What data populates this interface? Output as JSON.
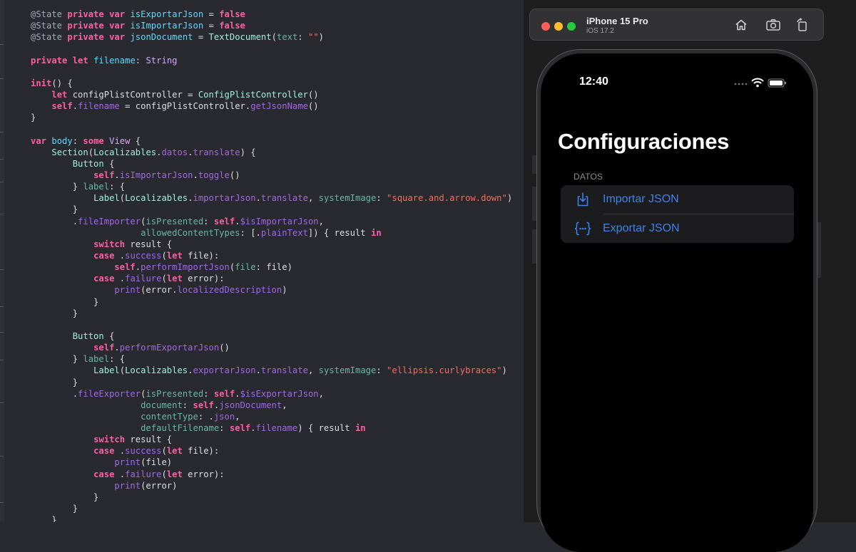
{
  "code": {
    "lines": [
      [
        [
          "at",
          "@State"
        ],
        [
          "pn",
          " "
        ],
        [
          "kw",
          "private"
        ],
        [
          "pn",
          " "
        ],
        [
          "kw",
          "var"
        ],
        [
          "pn",
          " "
        ],
        [
          "pr",
          "isExportarJson"
        ],
        [
          "pn",
          " = "
        ],
        [
          "kw",
          "false"
        ]
      ],
      [
        [
          "at",
          "@State"
        ],
        [
          "pn",
          " "
        ],
        [
          "kw",
          "private"
        ],
        [
          "pn",
          " "
        ],
        [
          "kw",
          "var"
        ],
        [
          "pn",
          " "
        ],
        [
          "pr",
          "isImportarJson"
        ],
        [
          "pn",
          " = "
        ],
        [
          "kw",
          "false"
        ]
      ],
      [
        [
          "at",
          "@State"
        ],
        [
          "pn",
          " "
        ],
        [
          "kw",
          "private"
        ],
        [
          "pn",
          " "
        ],
        [
          "kw",
          "var"
        ],
        [
          "pn",
          " "
        ],
        [
          "pr",
          "jsonDocument"
        ],
        [
          "pn",
          " = "
        ],
        [
          "cl",
          "TextDocument"
        ],
        [
          "pn",
          "("
        ],
        [
          "pt",
          "text"
        ],
        [
          "pn",
          ": "
        ],
        [
          "st",
          "\"\""
        ],
        [
          "pn",
          ")"
        ]
      ],
      [],
      [
        [
          "kw",
          "private"
        ],
        [
          "pn",
          " "
        ],
        [
          "kw",
          "let"
        ],
        [
          "pn",
          " "
        ],
        [
          "pr",
          "filename"
        ],
        [
          "pn",
          ": "
        ],
        [
          "ty",
          "String"
        ]
      ],
      [],
      [
        [
          "kw",
          "init"
        ],
        [
          "pn",
          "() {"
        ]
      ],
      [
        [
          "pn",
          "    "
        ],
        [
          "kw",
          "let"
        ],
        [
          "pn",
          " configPlistController = "
        ],
        [
          "cl",
          "ConfigPlistController"
        ],
        [
          "pn",
          "()"
        ]
      ],
      [
        [
          "pn",
          "    "
        ],
        [
          "kw",
          "self"
        ],
        [
          "pn",
          "."
        ],
        [
          "pm",
          "filename"
        ],
        [
          "pn",
          " = configPlistController."
        ],
        [
          "pm",
          "getJsonName"
        ],
        [
          "pn",
          "()"
        ]
      ],
      [
        [
          "pn",
          "}"
        ]
      ],
      [],
      [
        [
          "kw",
          "var"
        ],
        [
          "pn",
          " "
        ],
        [
          "pr",
          "body"
        ],
        [
          "pn",
          ": "
        ],
        [
          "kw",
          "some"
        ],
        [
          "pn",
          " "
        ],
        [
          "ty",
          "View"
        ],
        [
          "pn",
          " {"
        ]
      ],
      [
        [
          "pn",
          "    "
        ],
        [
          "cl",
          "Section"
        ],
        [
          "pn",
          "("
        ],
        [
          "cl",
          "Localizables"
        ],
        [
          "pn",
          "."
        ],
        [
          "pm",
          "datos"
        ],
        [
          "pn",
          "."
        ],
        [
          "pm",
          "translate"
        ],
        [
          "pn",
          ") {"
        ]
      ],
      [
        [
          "pn",
          "        "
        ],
        [
          "cl",
          "Button"
        ],
        [
          "pn",
          " {"
        ]
      ],
      [
        [
          "pn",
          "            "
        ],
        [
          "kw",
          "self"
        ],
        [
          "pn",
          "."
        ],
        [
          "pm",
          "isImportarJson"
        ],
        [
          "pn",
          "."
        ],
        [
          "pm",
          "toggle"
        ],
        [
          "pn",
          "()"
        ]
      ],
      [
        [
          "pn",
          "        } "
        ],
        [
          "pt",
          "label"
        ],
        [
          "pn",
          ": {"
        ]
      ],
      [
        [
          "pn",
          "            "
        ],
        [
          "cl",
          "Label"
        ],
        [
          "pn",
          "("
        ],
        [
          "cl",
          "Localizables"
        ],
        [
          "pn",
          "."
        ],
        [
          "pm",
          "importarJson"
        ],
        [
          "pn",
          "."
        ],
        [
          "pm",
          "translate"
        ],
        [
          "pn",
          ", "
        ],
        [
          "pt",
          "systemImage"
        ],
        [
          "pn",
          ": "
        ],
        [
          "st",
          "\"square.and.arrow.down\""
        ],
        [
          "pn",
          ")"
        ]
      ],
      [
        [
          "pn",
          "        }"
        ]
      ],
      [
        [
          "pn",
          "        ."
        ],
        [
          "pm",
          "fileImporter"
        ],
        [
          "pn",
          "("
        ],
        [
          "pt",
          "isPresented"
        ],
        [
          "pn",
          ": "
        ],
        [
          "kw",
          "self"
        ],
        [
          "pn",
          "."
        ],
        [
          "pm",
          "$isImportarJson"
        ],
        [
          "pn",
          ","
        ]
      ],
      [
        [
          "pn",
          "                     "
        ],
        [
          "pt",
          "allowedContentTypes"
        ],
        [
          "pn",
          ": [."
        ],
        [
          "pm",
          "plainText"
        ],
        [
          "pn",
          "]) { result "
        ],
        [
          "kw",
          "in"
        ]
      ],
      [
        [
          "pn",
          "            "
        ],
        [
          "kw",
          "switch"
        ],
        [
          "pn",
          " result {"
        ]
      ],
      [
        [
          "pn",
          "            "
        ],
        [
          "kw",
          "case"
        ],
        [
          "pn",
          " ."
        ],
        [
          "pm",
          "success"
        ],
        [
          "pn",
          "("
        ],
        [
          "kw",
          "let"
        ],
        [
          "pn",
          " file):"
        ]
      ],
      [
        [
          "pn",
          "                "
        ],
        [
          "kw",
          "self"
        ],
        [
          "pn",
          "."
        ],
        [
          "pm",
          "performImportJson"
        ],
        [
          "pn",
          "("
        ],
        [
          "pt",
          "file"
        ],
        [
          "pn",
          ": file)"
        ]
      ],
      [
        [
          "pn",
          "            "
        ],
        [
          "kw",
          "case"
        ],
        [
          "pn",
          " ."
        ],
        [
          "pm",
          "failure"
        ],
        [
          "pn",
          "("
        ],
        [
          "kw",
          "let"
        ],
        [
          "pn",
          " error):"
        ]
      ],
      [
        [
          "pn",
          "                "
        ],
        [
          "pm",
          "print"
        ],
        [
          "pn",
          "(error."
        ],
        [
          "pm",
          "localizedDescription"
        ],
        [
          "pn",
          ")"
        ]
      ],
      [
        [
          "pn",
          "            }"
        ]
      ],
      [
        [
          "pn",
          "        }"
        ]
      ],
      [],
      [
        [
          "pn",
          "        "
        ],
        [
          "cl",
          "Button"
        ],
        [
          "pn",
          " {"
        ]
      ],
      [
        [
          "pn",
          "            "
        ],
        [
          "kw",
          "self"
        ],
        [
          "pn",
          "."
        ],
        [
          "pm",
          "performExportarJson"
        ],
        [
          "pn",
          "()"
        ]
      ],
      [
        [
          "pn",
          "        } "
        ],
        [
          "pt",
          "label"
        ],
        [
          "pn",
          ": {"
        ]
      ],
      [
        [
          "pn",
          "            "
        ],
        [
          "cl",
          "Label"
        ],
        [
          "pn",
          "("
        ],
        [
          "cl",
          "Localizables"
        ],
        [
          "pn",
          "."
        ],
        [
          "pm",
          "exportarJson"
        ],
        [
          "pn",
          "."
        ],
        [
          "pm",
          "translate"
        ],
        [
          "pn",
          ", "
        ],
        [
          "pt",
          "systemImage"
        ],
        [
          "pn",
          ": "
        ],
        [
          "st",
          "\"ellipsis.curlybraces\""
        ],
        [
          "pn",
          ")"
        ]
      ],
      [
        [
          "pn",
          "        }"
        ]
      ],
      [
        [
          "pn",
          "        ."
        ],
        [
          "pm",
          "fileExporter"
        ],
        [
          "pn",
          "("
        ],
        [
          "pt",
          "isPresented"
        ],
        [
          "pn",
          ": "
        ],
        [
          "kw",
          "self"
        ],
        [
          "pn",
          "."
        ],
        [
          "pm",
          "$isExportarJson"
        ],
        [
          "pn",
          ","
        ]
      ],
      [
        [
          "pn",
          "                     "
        ],
        [
          "pt",
          "document"
        ],
        [
          "pn",
          ": "
        ],
        [
          "kw",
          "self"
        ],
        [
          "pn",
          "."
        ],
        [
          "pm",
          "jsonDocument"
        ],
        [
          "pn",
          ","
        ]
      ],
      [
        [
          "pn",
          "                     "
        ],
        [
          "pt",
          "contentType"
        ],
        [
          "pn",
          ": ."
        ],
        [
          "pm",
          "json"
        ],
        [
          "pn",
          ","
        ]
      ],
      [
        [
          "pn",
          "                     "
        ],
        [
          "pt",
          "defaultFilename"
        ],
        [
          "pn",
          ": "
        ],
        [
          "kw",
          "self"
        ],
        [
          "pn",
          "."
        ],
        [
          "pm",
          "filename"
        ],
        [
          "pn",
          ") { result "
        ],
        [
          "kw",
          "in"
        ]
      ],
      [
        [
          "pn",
          "            "
        ],
        [
          "kw",
          "switch"
        ],
        [
          "pn",
          " result {"
        ]
      ],
      [
        [
          "pn",
          "            "
        ],
        [
          "kw",
          "case"
        ],
        [
          "pn",
          " ."
        ],
        [
          "pm",
          "success"
        ],
        [
          "pn",
          "("
        ],
        [
          "kw",
          "let"
        ],
        [
          "pn",
          " file):"
        ]
      ],
      [
        [
          "pn",
          "                "
        ],
        [
          "pm",
          "print"
        ],
        [
          "pn",
          "(file)"
        ]
      ],
      [
        [
          "pn",
          "            "
        ],
        [
          "kw",
          "case"
        ],
        [
          "pn",
          " ."
        ],
        [
          "pm",
          "failure"
        ],
        [
          "pn",
          "("
        ],
        [
          "kw",
          "let"
        ],
        [
          "pn",
          " error):"
        ]
      ],
      [
        [
          "pn",
          "                "
        ],
        [
          "pm",
          "print"
        ],
        [
          "pn",
          "(error)"
        ]
      ],
      [
        [
          "pn",
          "            }"
        ]
      ],
      [
        [
          "pn",
          "        }"
        ]
      ],
      [
        [
          "pn",
          "    }"
        ]
      ]
    ]
  },
  "colors": {
    "editor_background": "#292a30",
    "keyword": "#fc5fa3",
    "string": "#fc6a5d",
    "property": "#5dd8ff",
    "type": "#d0a8ff",
    "class_name": "#9ef1dd",
    "member": "#a167e6",
    "parameter": "#67b7a4",
    "accent_blue": "#3f82ea",
    "traffic_close": "#ff5f57",
    "traffic_minimize": "#febc2e",
    "traffic_zoom": "#28c840"
  },
  "simulator": {
    "device_name": "iPhone 15 Pro",
    "os_version": "iOS 17.2",
    "toolbar_icons": [
      "home-icon",
      "screenshot-icon",
      "rotate-icon"
    ]
  },
  "phone": {
    "time": "12:40",
    "status_icons": [
      "more-dots-icon",
      "wifi-icon",
      "battery-icon"
    ],
    "title": "Configuraciones",
    "section_header": "DATOS",
    "rows": [
      {
        "label": "Importar JSON",
        "icon": "square-and-arrow-down-icon"
      },
      {
        "label": "Exportar JSON",
        "icon": "ellipsis-curlybraces-icon"
      }
    ]
  }
}
